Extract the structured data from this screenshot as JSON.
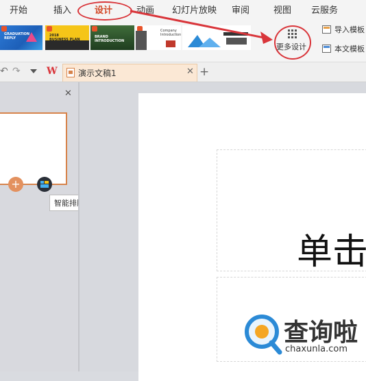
{
  "menu": {
    "items": [
      "开始",
      "插入",
      "设计",
      "动画",
      "幻灯片放映",
      "审阅",
      "视图",
      "云服务"
    ],
    "active_index": 2
  },
  "ribbon": {
    "templates": [
      {
        "label": "GRADUATION\nREPLY"
      },
      {
        "label": "2018\nBUSINESS PLAN"
      },
      {
        "label": "BRAND\nINTRODUCTION"
      },
      {
        "label": "Company\nIntroduction"
      },
      {
        "label": ""
      }
    ],
    "more_design_label": "更多设计",
    "import_template_label": "导入模板",
    "this_doc_template_label": "本文模板"
  },
  "tabbar": {
    "app_logo": "W",
    "doc_tab_title": "演示文稿1"
  },
  "thumbnail_panel": {
    "tooltip": "智能排版"
  },
  "slide": {
    "title_text": "单击"
  },
  "watermark": {
    "text": "查询啦",
    "url": "chaxunla.com"
  },
  "colors": {
    "accent": "#d9353a",
    "orange": "#d7834a"
  }
}
